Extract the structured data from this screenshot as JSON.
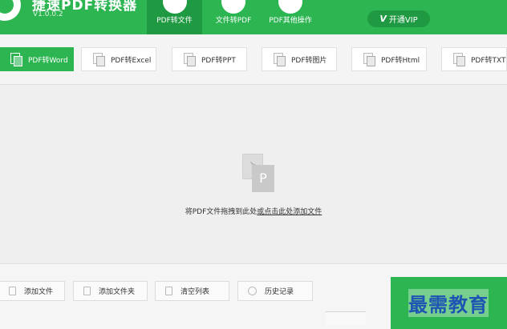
{
  "app": {
    "title": "捷速PDF转换器",
    "version": "V1.0.0.2"
  },
  "nav": {
    "tabs": [
      {
        "label": "PDF转文件",
        "icon": "file-icon",
        "active": true
      },
      {
        "label": "文件转PDF",
        "icon": "convert-icon",
        "active": false
      },
      {
        "label": "PDF其他操作",
        "icon": "tools-icon",
        "active": false
      }
    ],
    "vip": {
      "icon_text": "V",
      "label": "开通VIP"
    }
  },
  "convert_tabs": [
    {
      "label": "PDF转Word",
      "active": true
    },
    {
      "label": "PDF转Excel",
      "active": false
    },
    {
      "label": "PDF转PPT",
      "active": false
    },
    {
      "label": "PDF转图片",
      "active": false
    },
    {
      "label": "PDF转Html",
      "active": false
    },
    {
      "label": "PDF转TXT",
      "active": false
    }
  ],
  "drop": {
    "icon_back": "↘",
    "icon_front": "P",
    "text_prefix": "将PDF文件拖拽到此处",
    "text_link": "或点击此处添加文件"
  },
  "toolbar": {
    "add_file": "添加文件",
    "add_folder": "添加文件夹",
    "clear_list": "清空列表",
    "history": "历史记录"
  },
  "watermark": "最需教育",
  "colors": {
    "brand_green": "#2db552",
    "dark_green": "#1f9a42",
    "watermark_blue": "#1e55b3"
  }
}
